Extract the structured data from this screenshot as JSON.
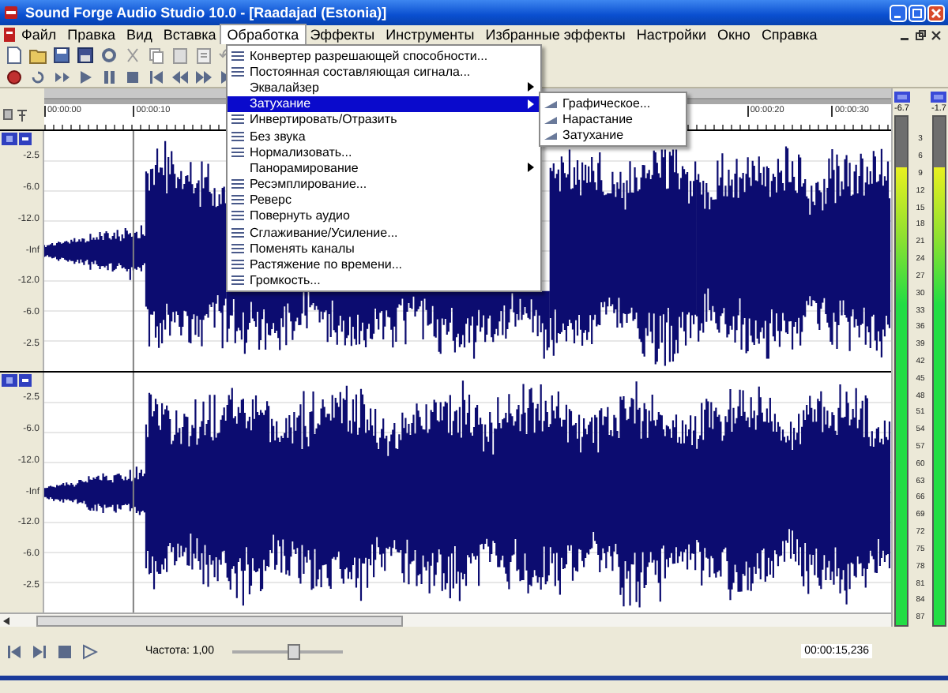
{
  "window": {
    "title": "Sound Forge Audio Studio 10.0 - [Raadajad (Estonia)]"
  },
  "menu_bar": {
    "items": [
      {
        "label": "Файл",
        "selected": false
      },
      {
        "label": "Правка",
        "selected": false
      },
      {
        "label": "Вид",
        "selected": false
      },
      {
        "label": "Вставка",
        "selected": false
      },
      {
        "label": "Обработка",
        "selected": true
      },
      {
        "label": "Эффекты",
        "selected": false
      },
      {
        "label": "Инструменты",
        "selected": false
      },
      {
        "label": "Избранные эффекты",
        "selected": false
      },
      {
        "label": "Настройки",
        "selected": false
      },
      {
        "label": "Окно",
        "selected": false
      },
      {
        "label": "Справка",
        "selected": false
      }
    ]
  },
  "open_menu": {
    "items": [
      {
        "label": "Конвертер разрешающей способности...",
        "kind": "command",
        "selected": false
      },
      {
        "label": "Постоянная составляющая сигнала...",
        "kind": "command",
        "selected": false
      },
      {
        "label": "Эквалайзер",
        "kind": "submenu",
        "selected": false
      },
      {
        "label": "Затухание",
        "kind": "submenu",
        "selected": true
      },
      {
        "label": "Инвертировать/Отразить",
        "kind": "command",
        "selected": false
      },
      {
        "label": "Без звука",
        "kind": "command",
        "selected": false
      },
      {
        "label": "Нормализовать...",
        "kind": "command",
        "selected": false
      },
      {
        "label": "Панорамирование",
        "kind": "submenu",
        "selected": false
      },
      {
        "label": "Ресэмплирование...",
        "kind": "command",
        "selected": false
      },
      {
        "label": "Реверс",
        "kind": "command",
        "selected": false
      },
      {
        "label": "Повернуть аудио",
        "kind": "command",
        "selected": false
      },
      {
        "label": "Сглаживание/Усиление...",
        "kind": "command",
        "selected": false
      },
      {
        "label": "Поменять каналы",
        "kind": "command",
        "selected": false
      },
      {
        "label": "Растяжение по времени...",
        "kind": "command",
        "selected": false
      },
      {
        "label": "Громкость...",
        "kind": "command",
        "selected": false
      }
    ],
    "submenu": {
      "items": [
        {
          "label": "Графическое...",
          "selected": false
        },
        {
          "label": "Нарастание",
          "selected": false
        },
        {
          "label": "Затухание",
          "selected": false
        }
      ]
    }
  },
  "ruler": {
    "labels": [
      "00:00:00",
      "00:00:10",
      "00:00:20",
      "00:00:30"
    ]
  },
  "tracks": [
    {
      "scale_labels": [
        "-2.5",
        "-6.0",
        "-12.0",
        "-Inf",
        "-12.0",
        "-6.0",
        "-2.5"
      ]
    },
    {
      "scale_labels": [
        "-2.5",
        "-6.0",
        "-12.0",
        "-Inf",
        "-12.0",
        "-6.0",
        "-2.5"
      ]
    }
  ],
  "meters": {
    "peak_labels": [
      "-6.7",
      "-1.7"
    ],
    "channels": [
      {
        "level": 0.9
      },
      {
        "level": 0.9
      }
    ],
    "scale": [
      "3",
      "6",
      "9",
      "12",
      "15",
      "18",
      "21",
      "24",
      "27",
      "30",
      "33",
      "36",
      "39",
      "42",
      "45",
      "48",
      "51",
      "54",
      "57",
      "60",
      "63",
      "66",
      "69",
      "72",
      "75",
      "78",
      "81",
      "84",
      "87"
    ]
  },
  "transport": {
    "rate_label": "Частота: 1,00",
    "rate_slider": {
      "level": 0.55
    },
    "time": "00:00:15,236"
  }
}
